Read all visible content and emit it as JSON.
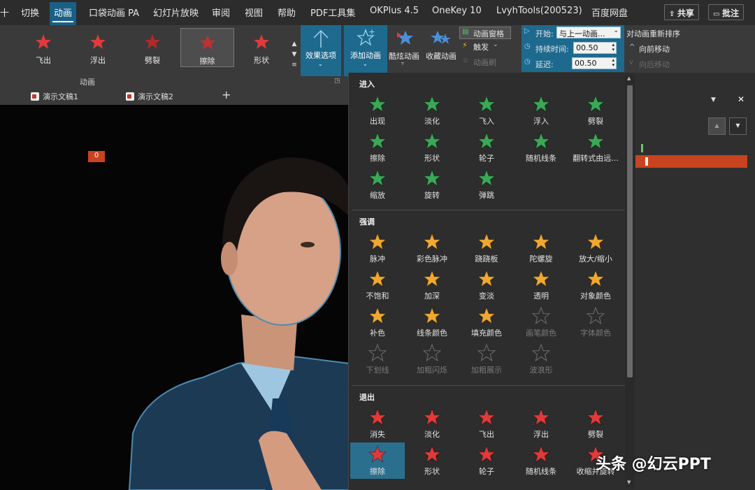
{
  "menubar": {
    "items": [
      "十",
      "切换",
      "动画",
      "口袋动画 PA",
      "幻灯片放映",
      "审阅",
      "视图",
      "帮助",
      "PDF工具集",
      "OKPlus 4.5",
      "OneKey 10",
      "LvyhTools(200523)",
      "百度网盘"
    ],
    "active": "动画",
    "share": "共享",
    "comment": "批注"
  },
  "ribbon": {
    "gallery": [
      "飞出",
      "浮出",
      "劈裂",
      "擦除",
      "形状"
    ],
    "gallery_selected": "擦除",
    "group_label": "动画",
    "effect_options": "效果选项",
    "add_animation": "添加动画",
    "cool_animation": "酷炫动画",
    "favorite_animation": "收藏动画",
    "animation_pane": "动画窗格",
    "trigger": "触发",
    "animation_painter": "动画刷",
    "start_label": "开始:",
    "start_value": "与上一动画...",
    "duration_label": "持续时间:",
    "duration_value": "00.50",
    "delay_label": "延迟:",
    "delay_value": "00.50",
    "reorder_title": "对动画重新排序",
    "move_earlier": "向前移动",
    "move_later": "向后移动"
  },
  "tabs": [
    "演示文稿1",
    "演示文稿2",
    "+"
  ],
  "canvas": {
    "badge": "0"
  },
  "panel": {
    "sections": [
      {
        "title": "进入",
        "items": [
          {
            "label": "出现",
            "color": "#3aa856",
            "disabled": false
          },
          {
            "label": "淡化",
            "color": "#3aa856",
            "disabled": false
          },
          {
            "label": "飞入",
            "color": "#3aa856",
            "disabled": false
          },
          {
            "label": "浮入",
            "color": "#3aa856",
            "disabled": false
          },
          {
            "label": "劈裂",
            "color": "#3aa856",
            "disabled": false
          },
          {
            "label": "擦除",
            "color": "#3aa856",
            "disabled": false
          },
          {
            "label": "形状",
            "color": "#3aa856",
            "disabled": false
          },
          {
            "label": "轮子",
            "color": "#3aa856",
            "disabled": false
          },
          {
            "label": "随机线条",
            "color": "#3aa856",
            "disabled": false
          },
          {
            "label": "翻转式由远...",
            "color": "#3aa856",
            "disabled": false
          },
          {
            "label": "缩放",
            "color": "#3aa856",
            "disabled": false
          },
          {
            "label": "旋转",
            "color": "#3aa856",
            "disabled": false
          },
          {
            "label": "弹跳",
            "color": "#3aa856",
            "disabled": false
          }
        ]
      },
      {
        "title": "强调",
        "items": [
          {
            "label": "脉冲",
            "color": "#f0a830",
            "disabled": false
          },
          {
            "label": "彩色脉冲",
            "color": "#f0a830",
            "disabled": false
          },
          {
            "label": "跷跷板",
            "color": "#f0a830",
            "disabled": false
          },
          {
            "label": "陀螺旋",
            "color": "#f0a830",
            "disabled": false
          },
          {
            "label": "放大/缩小",
            "color": "#f0a830",
            "disabled": false
          },
          {
            "label": "不饱和",
            "color": "#f0a830",
            "disabled": false
          },
          {
            "label": "加深",
            "color": "#f0a830",
            "disabled": false
          },
          {
            "label": "变淡",
            "color": "#f0a830",
            "disabled": false
          },
          {
            "label": "透明",
            "color": "#f0a830",
            "disabled": false
          },
          {
            "label": "对象颜色",
            "color": "#f0a830",
            "disabled": false
          },
          {
            "label": "补色",
            "color": "#f0a830",
            "disabled": false
          },
          {
            "label": "线条颜色",
            "color": "#f0a830",
            "disabled": false
          },
          {
            "label": "填充颜色",
            "color": "#f0a830",
            "disabled": false
          },
          {
            "label": "画笔颜色",
            "color": "#6a6a6a",
            "disabled": true
          },
          {
            "label": "字体颜色",
            "color": "#6a6a6a",
            "disabled": true
          },
          {
            "label": "下划线",
            "color": "#6a6a6a",
            "disabled": true
          },
          {
            "label": "加粗闪烁",
            "color": "#6a6a6a",
            "disabled": true
          },
          {
            "label": "加粗展示",
            "color": "#6a6a6a",
            "disabled": true
          },
          {
            "label": "波浪形",
            "color": "#6a6a6a",
            "disabled": true
          }
        ]
      },
      {
        "title": "退出",
        "items": [
          {
            "label": "消失",
            "color": "#e03a3a",
            "disabled": false
          },
          {
            "label": "淡化",
            "color": "#e03a3a",
            "disabled": false
          },
          {
            "label": "飞出",
            "color": "#e03a3a",
            "disabled": false
          },
          {
            "label": "浮出",
            "color": "#e03a3a",
            "disabled": false
          },
          {
            "label": "劈裂",
            "color": "#e03a3a",
            "disabled": false
          },
          {
            "label": "擦除",
            "color": "#e03a3a",
            "disabled": false
          },
          {
            "label": "形状",
            "color": "#e03a3a",
            "disabled": false
          },
          {
            "label": "轮子",
            "color": "#e03a3a",
            "disabled": false
          },
          {
            "label": "随机线条",
            "color": "#e03a3a",
            "disabled": false
          },
          {
            "label": "收缩并旋转",
            "color": "#e03a3a",
            "disabled": false
          }
        ]
      }
    ],
    "selected": "擦除"
  },
  "watermark": "头条 @幻云PPT"
}
